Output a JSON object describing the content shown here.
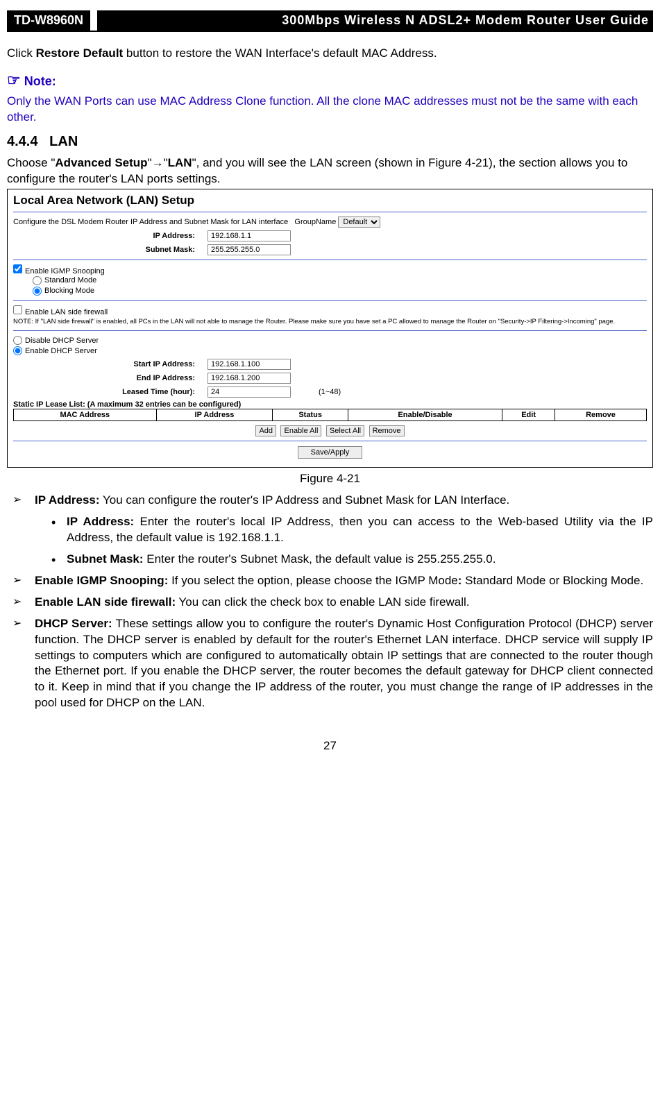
{
  "header": {
    "model": "TD-W8960N",
    "title": "300Mbps Wireless N ADSL2+ Modem Router User Guide"
  },
  "intro": {
    "p1_pre": "Click ",
    "p1_bold": "Restore Default",
    "p1_post": " button to restore the WAN Interface's default MAC Address."
  },
  "note": {
    "label": "Note:",
    "text": "Only the WAN Ports can use MAC Address Clone function. All the clone MAC addresses must not be the same with each other."
  },
  "section": {
    "num": "4.4.4",
    "title": "LAN"
  },
  "nav": {
    "pre": "Choose \"",
    "b1": "Advanced Setup",
    "mid": "\"→\"",
    "b2": "LAN",
    "post": "\", and you will see the LAN screen (shown in Figure 4-21), the section allows you to configure the router's LAN ports settings."
  },
  "figure": {
    "title": "Local Area Network (LAN) Setup",
    "confline": "Configure the DSL Modem Router IP Address and Subnet Mask for LAN interface",
    "groupname_lbl": "GroupName",
    "groupname_val": "Default",
    "ip_lbl": "IP Address:",
    "ip_val": "192.168.1.1",
    "mask_lbl": "Subnet Mask:",
    "mask_val": "255.255.255.0",
    "igmp": "Enable IGMP Snooping",
    "std": "Standard Mode",
    "blk": "Blocking Mode",
    "lanfw": "Enable LAN side firewall",
    "lanfw_note": "NOTE: If \"LAN side firewall\" is enabled, all PCs in the LAN will not able to manage the Router. Please make sure you have set a PC allowed to manage the Router on \"Security->IP Filtering->Incoming\" page.",
    "dhcp_dis": "Disable DHCP Server",
    "dhcp_en": "Enable DHCP Server",
    "start_lbl": "Start IP Address:",
    "start_val": "192.168.1.100",
    "end_lbl": "End IP Address:",
    "end_val": "192.168.1.200",
    "lease_lbl": "Leased Time (hour):",
    "lease_val": "24",
    "lease_hint": "(1~48)",
    "static": "Static IP Lease List: (A maximum 32 entries can be configured)",
    "th1": "MAC Address",
    "th2": "IP Address",
    "th3": "Status",
    "th4": "Enable/Disable",
    "th5": "Edit",
    "th6": "Remove",
    "b_add": "Add",
    "b_ena": "Enable All",
    "b_sel": "Select All",
    "b_rem": "Remove",
    "b_save": "Save/Apply"
  },
  "caption": "Figure 4-21",
  "list": {
    "i1_b": "IP Address:",
    "i1_t": " You can configure the router's IP Address and Subnet Mask for LAN Interface.",
    "i1a_b": "IP Address:",
    "i1a_t": " Enter the router's local IP Address, then you can access to the Web-based Utility via the IP Address, the default value is 192.168.1.1.",
    "i1b_b": "Subnet Mask:",
    "i1b_t": " Enter the router's Subnet Mask, the default value is 255.255.255.0.",
    "i2_b": "Enable IGMP Snooping:",
    "i2_t": " If you select the option, please choose the IGMP Mode",
    "i2_b2": ":",
    "i2_t2": " Standard Mode or Blocking Mode.",
    "i3_b": "Enable LAN side firewall:",
    "i3_t": " You can click the check box to enable LAN side firewall.",
    "i4_b": "DHCP Server:",
    "i4_t": " These settings allow you to configure the router's Dynamic Host Configuration Protocol (DHCP) server function. The DHCP server is enabled by default for the router's Ethernet LAN interface. DHCP service will supply IP settings to computers which are configured to automatically obtain IP settings that are connected to the router though the Ethernet port. If you enable the DHCP server, the router becomes the default gateway for DHCP client connected to it. Keep in mind that if you change the IP address of the router, you must change the range of IP addresses in the pool used for DHCP on the LAN."
  },
  "page": "27"
}
